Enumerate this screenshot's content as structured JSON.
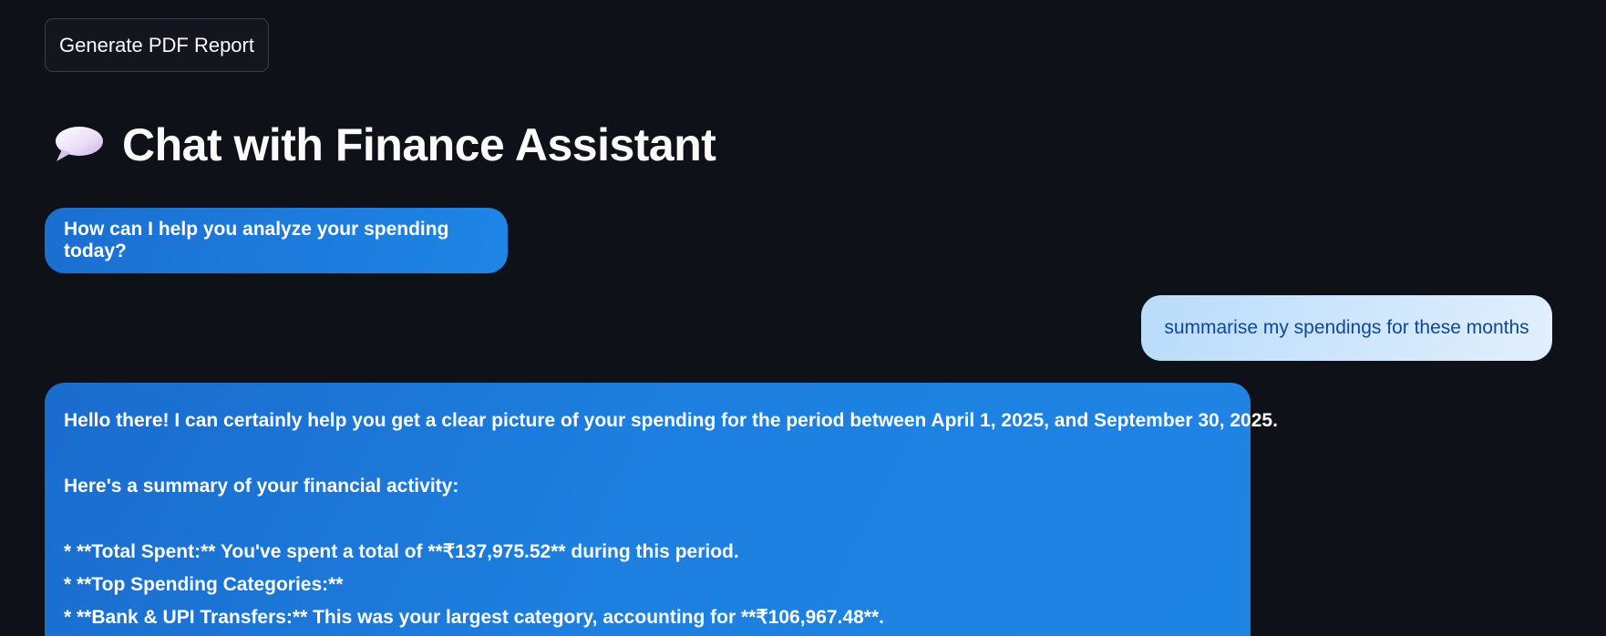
{
  "toolbar": {
    "pdf_button_label": "Generate PDF Report"
  },
  "header": {
    "icon": "speech-balloon-icon",
    "title": "Chat with Finance Assistant"
  },
  "messages": [
    {
      "role": "assistant",
      "text": "How can I help you analyze your spending today?"
    },
    {
      "role": "user",
      "text": "summarise my spendings for these months"
    },
    {
      "role": "assistant",
      "lines": [
        "Hello there! I can certainly help you get a clear picture of your spending for the period between April 1, 2025, and September 30, 2025.",
        "Here's a summary of your financial activity:",
        "* **Total Spent:** You've spent a total of **₹137,975.52** during this period.",
        "* **Top Spending Categories:**",
        "* **Bank & UPI Transfers:** This was your largest category, accounting for **₹106,967.48**."
      ]
    }
  ],
  "colors": {
    "background": "#0e1117",
    "assistant_bubble": "#1e85e6",
    "user_bubble": "#cfe6fc",
    "user_text": "#0d47a1"
  }
}
